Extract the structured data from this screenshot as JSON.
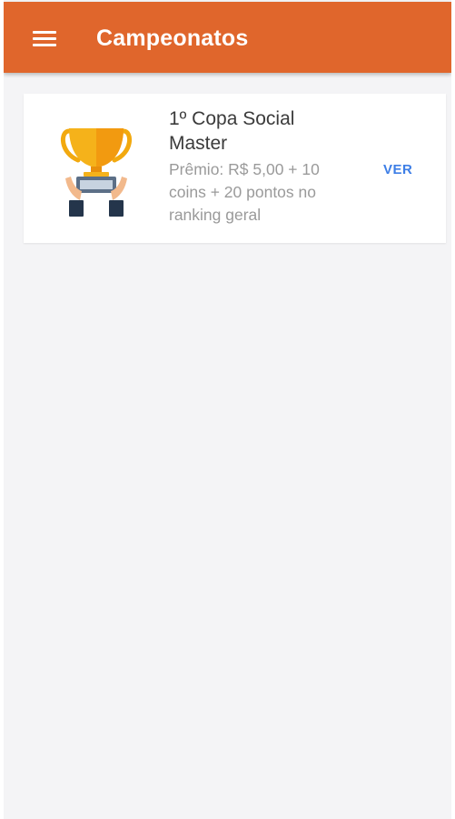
{
  "appbar": {
    "title": "Campeonatos",
    "menu_icon": "hamburger-menu-icon",
    "background_color": "#e0662c"
  },
  "championships": [
    {
      "title": "1º Copa Social Master",
      "description": "Prêmio: R$ 5,00 + 10 coins + 20 pontos no ranking geral",
      "action_label": "VER",
      "icon": "trophy-icon"
    }
  ],
  "colors": {
    "accent": "#3d7ee6",
    "page_background": "#f4f4f6"
  }
}
